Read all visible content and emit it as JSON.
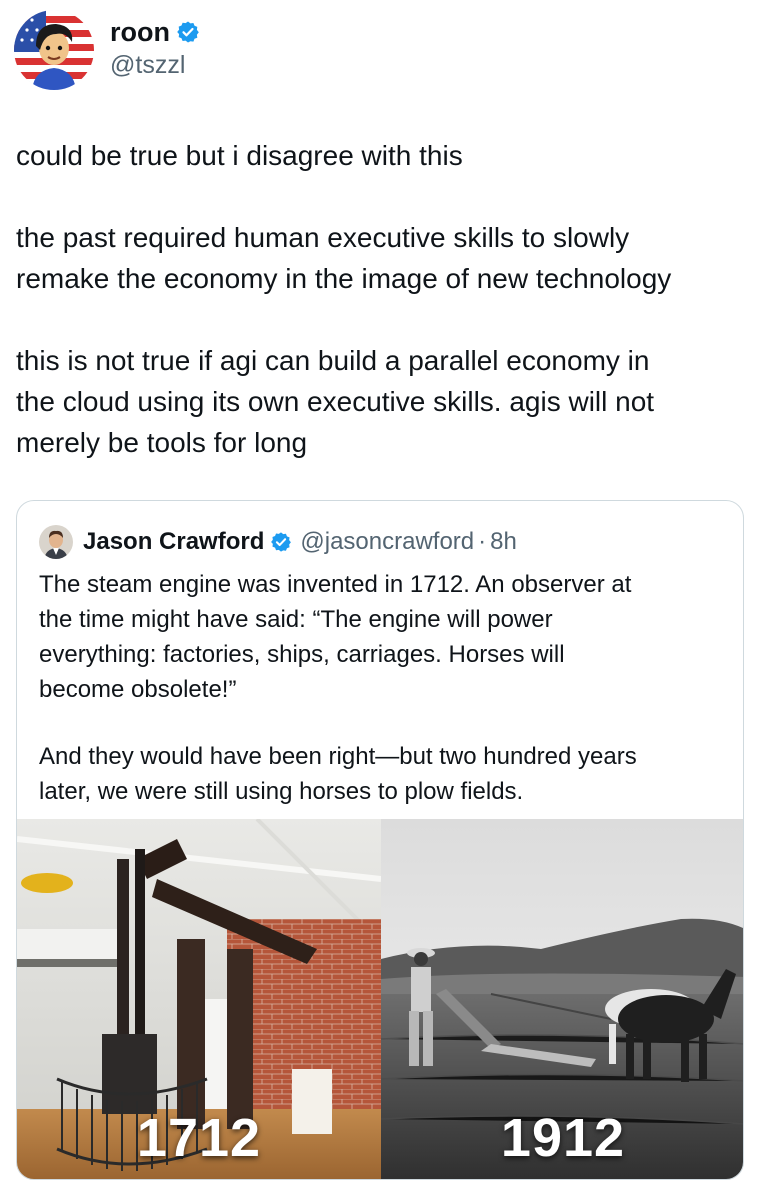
{
  "author": {
    "name": "roon",
    "handle": "@tszzl"
  },
  "post": {
    "lines_p1": [
      "could be true but i disagree with this"
    ],
    "lines_p2": [
      "the past required human executive skills to slowly",
      "remake the economy in the image of new technology"
    ],
    "lines_p3": [
      "this is not true if agi can build a parallel economy in",
      "the cloud using its own executive skills. agis will not",
      "merely be tools for long"
    ]
  },
  "quote": {
    "name": "Jason Crawford",
    "handle": "@jasoncrawford",
    "dot": "·",
    "time": "8h",
    "lines_p1": [
      "The steam engine was invented in 1712. An observer at",
      "the time might have said: “The engine will power",
      "everything: factories, ships, carriages. Horses will",
      "become obsolete!”"
    ],
    "lines_p2": [
      "And they would have been right—but two hundred years",
      "later, we were still using horses to plow fields."
    ],
    "media": {
      "left_year": "1712",
      "right_year": "1912"
    }
  },
  "colors": {
    "verified": "#1d9bf0",
    "secondary_text": "#536471",
    "border": "#cfd9de"
  },
  "icons": {
    "verified": "verified-badge-icon"
  }
}
